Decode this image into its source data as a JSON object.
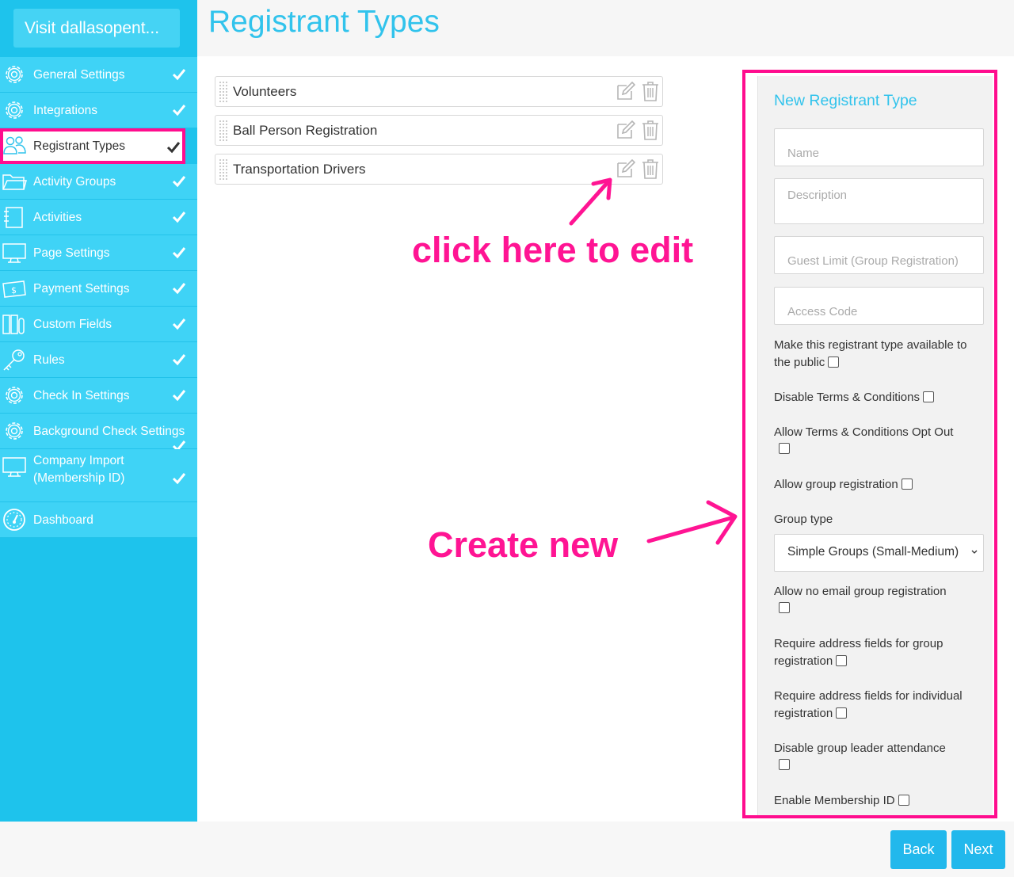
{
  "sidebar": {
    "visit_label": "Visit dallasopent...",
    "items": [
      {
        "label": "General Settings",
        "icon": "gear-icon"
      },
      {
        "label": "Integrations",
        "icon": "gear-icon"
      },
      {
        "label": "Registrant Types",
        "icon": "users-icon"
      },
      {
        "label": "Activity Groups",
        "icon": "folder-icon"
      },
      {
        "label": "Activities",
        "icon": "notebook-icon"
      },
      {
        "label": "Page Settings",
        "icon": "monitor-icon"
      },
      {
        "label": "Payment Settings",
        "icon": "money-icon"
      },
      {
        "label": "Custom Fields",
        "icon": "columns-icon"
      },
      {
        "label": "Rules",
        "icon": "key-icon"
      },
      {
        "label": "Check In Settings",
        "icon": "gear-icon"
      },
      {
        "label": "Background Check Settings",
        "icon": "gear-icon"
      },
      {
        "label": "Company Import (Membership ID)",
        "icon": "monitor-icon"
      },
      {
        "label": "Dashboard",
        "icon": "speedometer-icon"
      }
    ]
  },
  "header": {
    "title": "Registrant Types"
  },
  "registrant_types": [
    "Volunteers",
    "Ball Person Registration",
    "Transportation Drivers"
  ],
  "annotations": {
    "edit": "click here to edit",
    "create": "Create new"
  },
  "form": {
    "title": "New Registrant Type",
    "placeholders": {
      "name": "Name",
      "description": "Description",
      "guest_limit": "Guest Limit (Group Registration)",
      "access_code": "Access Code"
    },
    "options": {
      "public": "Make this registrant type available to the public",
      "disable_terms": "Disable Terms & Conditions",
      "terms_opt_out": "Allow Terms & Conditions Opt Out",
      "group_registration": "Allow group registration",
      "group_type_label": "Group type",
      "no_email_group": "Allow no email group registration",
      "address_group": "Require address fields for group registration",
      "address_individual": "Require address fields for individual registration",
      "disable_leader_attendance": "Disable group leader attendance",
      "membership_id": "Enable Membership ID"
    },
    "group_type_value": "Simple Groups (Small-Medium)"
  },
  "footer": {
    "back_label": "Back",
    "next_label": "Next"
  },
  "colors": {
    "accent": "#1ec3ec",
    "highlight": "#ff0d8e",
    "button": "#22b8ec"
  }
}
